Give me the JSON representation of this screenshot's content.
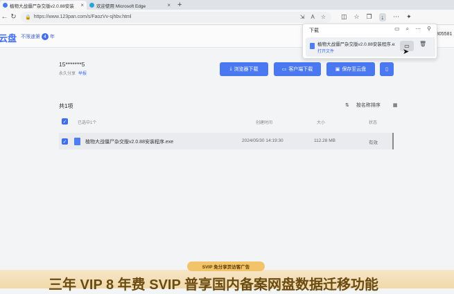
{
  "browser": {
    "tabs": [
      {
        "title": "植物大战僵尸杂交版v2.0.88安装",
        "icon_color": "#4a78f0"
      },
      {
        "title": "欢迎使用 Microsoft Edge",
        "icon_color": "#2aa3d8"
      }
    ],
    "new_tab": "+",
    "url": "https://www.123pan.com/s/FaozVv-sjhbv.html",
    "icons": [
      "back-icon",
      "reload-icon",
      "lock-icon",
      "read-aloud-icon",
      "favorite-star-icon",
      "split-icon",
      "favorites-icon",
      "collections-icon",
      "downloads-icon",
      "copilot-icon"
    ]
  },
  "site": {
    "logo": "云盘",
    "slogan": "不限速第",
    "years": "4",
    "slogan_suffix": "年",
    "edge_number": "805581"
  },
  "share": {
    "code": "15*******5",
    "meta": "永久分享",
    "report": "举报"
  },
  "buttons": {
    "browser_download": "浏览器下载",
    "client_download": "客户端下载",
    "save": "保存至云盘"
  },
  "list": {
    "count": "共1项",
    "sort": "按名称排序",
    "headers": {
      "selected": "已选中1个",
      "time": "创建时间",
      "size": "大小",
      "status": "状态"
    },
    "rows": [
      {
        "name": "植物大战僵尸杂交版v2.0.88安装程序.exe",
        "time": "2024/05/30 14:19:30",
        "size": "112.28 MB",
        "status": "有效"
      }
    ]
  },
  "download_panel": {
    "title": "下载",
    "file": "植物大战僵尸杂交版v2.0.88安装程序.exe",
    "open": "打开文件"
  },
  "promo": {
    "badge": "SVIP 免分享页访客广告",
    "headline": "三年 VIP 8 年费 SVIP 普享国内备案网盘数据迁移功能"
  }
}
